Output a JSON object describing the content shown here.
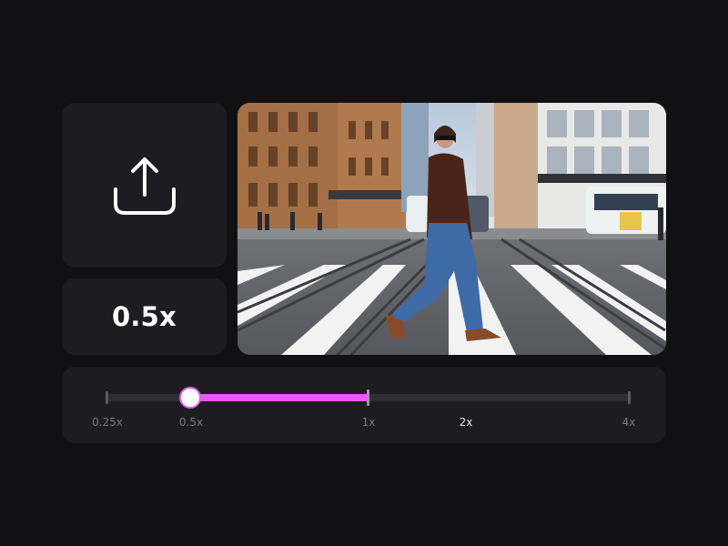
{
  "speed": {
    "current_label": "0.5x"
  },
  "upload": {
    "icon": "upload-icon"
  },
  "slider": {
    "stops": [
      "0.25x",
      "0.5x",
      "1x",
      "2x",
      "4x"
    ],
    "value_label": "0.5x",
    "highlighted_label": "2x"
  },
  "colors": {
    "accent": "#e45cf0",
    "background": "#111114",
    "panel": "#1d1d21"
  }
}
